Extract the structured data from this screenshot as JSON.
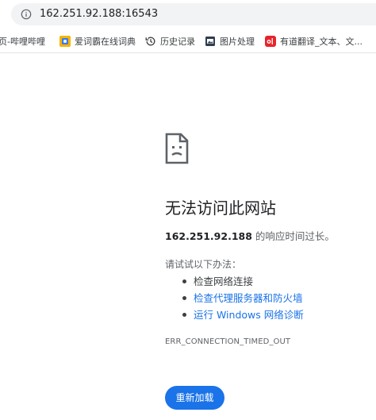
{
  "omnibox": {
    "url": "162.251.92.188:16543",
    "icon": "info-icon"
  },
  "bookmarks": [
    {
      "label": "页-哔哩哔哩",
      "icon": "none"
    },
    {
      "label": "爱词霸在线词典",
      "icon": "iciba-icon"
    },
    {
      "label": "历史记录",
      "icon": "history-icon"
    },
    {
      "label": "图片处理",
      "icon": "image-tool-icon"
    },
    {
      "label": "有道翻译_文本、文...",
      "icon": "youdao-icon"
    }
  ],
  "error": {
    "icon": "sad-document-icon",
    "title": "无法访问此网站",
    "host": "162.251.92.188",
    "host_suffix": " 的响应时间过长。",
    "try_label": "请试试以下办法：",
    "suggestions": [
      {
        "label": "检查网络连接",
        "link": false
      },
      {
        "label": "检查代理服务器和防火墙",
        "link": true
      },
      {
        "label": "运行 Windows 网络诊断",
        "link": true
      }
    ],
    "code": "ERR_CONNECTION_TIMED_OUT",
    "reload_label": "重新加载"
  },
  "colors": {
    "accent": "#1a73e8",
    "omnibox_bg": "#f1f3f4",
    "text_primary": "#202124",
    "text_secondary": "#5f6368"
  }
}
